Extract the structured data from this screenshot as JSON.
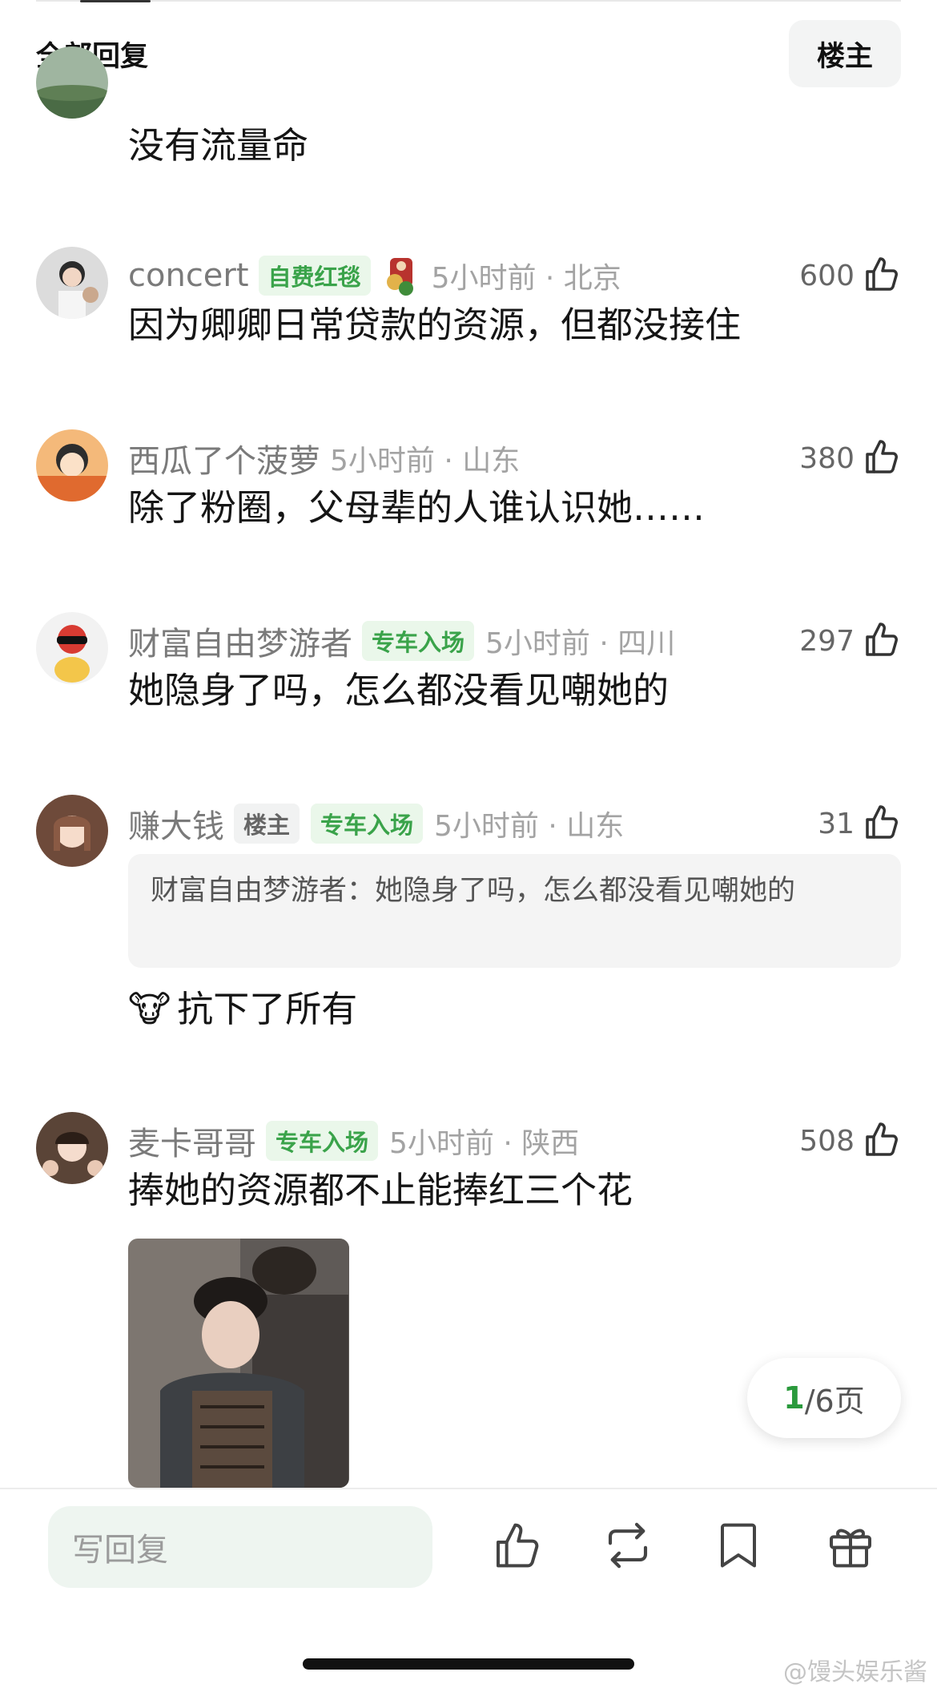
{
  "header": {
    "title": "全部回复",
    "op_label": "楼主"
  },
  "comments": [
    {
      "text": "没有流量命"
    },
    {
      "username": "concert",
      "tags": [
        "自费红毯"
      ],
      "time_location": "5小时前 · 北京",
      "likes": "600",
      "text": "因为卿卿日常贷款的资源，但都没接住"
    },
    {
      "username": "西瓜了个菠萝",
      "time_location": "5小时前 · 山东",
      "likes": "380",
      "text": "除了粉圈，父母辈的人谁认识她……"
    },
    {
      "username": "财富自由梦游者",
      "tags": [
        "专车入场"
      ],
      "time_location": "5小时前 · 四川",
      "likes": "297",
      "text": "她隐身了吗，怎么都没看见嘲她的"
    },
    {
      "username": "赚大钱",
      "tags": [
        "楼主",
        "专车入场"
      ],
      "time_location": "5小时前 · 山东",
      "likes": "31",
      "quote": "财富自由梦游者：她隐身了吗，怎么都没看见嘲她的",
      "emoji": "🐮",
      "text": "抗下了所有"
    },
    {
      "username": "麦卡哥哥",
      "tags": [
        "专车入场"
      ],
      "time_location": "5小时前 · 陕西",
      "likes": "508",
      "text": "捧她的资源都不止能捧红三个花"
    }
  ],
  "pagination": {
    "current": "1",
    "total": "/6页"
  },
  "bottom_bar": {
    "reply_placeholder": "写回复"
  },
  "watermark": "@馒头娱乐酱",
  "icons": [
    "thumbs-up-icon",
    "repost-icon",
    "bookmark-icon",
    "gift-icon"
  ],
  "colors": {
    "accent": "#3aa34a",
    "tag_bg": "#eaf7ea"
  }
}
